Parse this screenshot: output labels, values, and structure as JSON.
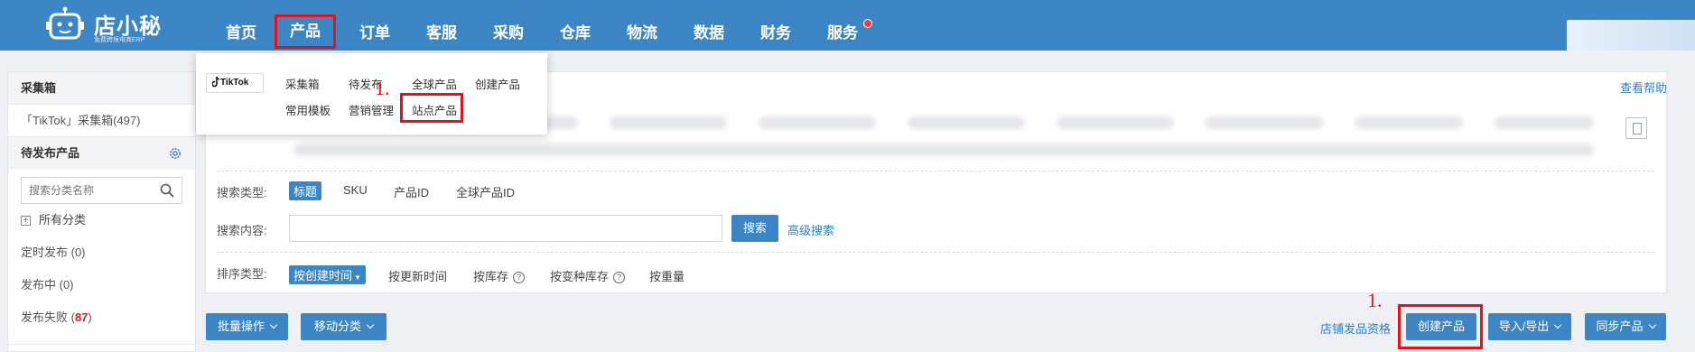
{
  "header": {
    "brand": "店小秘",
    "brand_sub": "免费跨境电商ERP",
    "nav": [
      "首页",
      "产品",
      "订单",
      "客服",
      "采购",
      "仓库",
      "物流",
      "数据",
      "财务",
      "服务"
    ]
  },
  "dropdown": {
    "platform": "TikTok",
    "items_row1": [
      "采集箱",
      "待发布",
      "全球产品",
      "创建产品"
    ],
    "items_row2": [
      "常用模板",
      "营销管理",
      "站点产品"
    ]
  },
  "sidebar": {
    "collect_title": "采集箱",
    "collect_link": "「TikTok」采集箱(497)",
    "pending_title": "待发布产品",
    "search_placeholder": "搜索分类名称",
    "all_categories": "所有分类",
    "items": [
      {
        "label": "定时发布 (0)"
      },
      {
        "label": "发布中 (0)"
      },
      {
        "label_prefix": "发布失败 (",
        "count": "87",
        "label_suffix": ")"
      }
    ]
  },
  "main": {
    "help_link": "查看帮助",
    "search_type_label": "搜索类型:",
    "search_types": [
      "标题",
      "SKU",
      "产品ID",
      "全球产品ID"
    ],
    "search_content_label": "搜索内容:",
    "search_button": "搜索",
    "advanced_search": "高级搜索",
    "sort_label": "排序类型:",
    "sort_options": [
      "按创建时间",
      "按更新时间",
      "按库存",
      "按变种库存",
      "按重量"
    ]
  },
  "actions": {
    "bulk": "批量操作",
    "move": "移动分类",
    "shop_qualification": "店铺发品资格",
    "create": "创建产品",
    "import_export": "导入/导出",
    "sync": "同步产品"
  },
  "annotations": {
    "step_dropdown": "1.",
    "step_button": "1."
  },
  "colors": {
    "topbar": "#3d86c6",
    "primary": "#3d86c6",
    "highlight": "#e0141e",
    "link": "#2f7fc7"
  }
}
